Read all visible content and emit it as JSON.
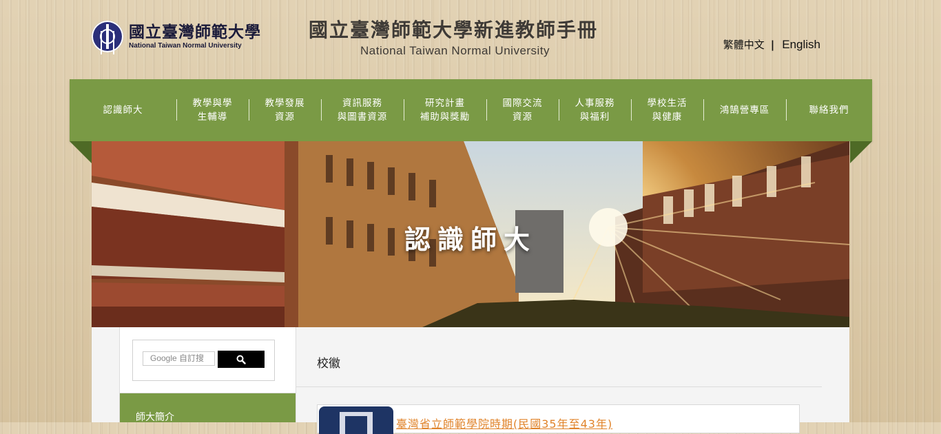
{
  "header": {
    "logo_zh": "國立臺灣師範大學",
    "logo_en": "National Taiwan Normal University",
    "site_title_zh": "國立臺灣師範大學新進教師手冊",
    "site_title_en": "National Taiwan Normal University",
    "lang_zh": "繁體中文",
    "lang_sep": "|",
    "lang_en": "English"
  },
  "nav": {
    "items": [
      {
        "line1": "認識師大",
        "line2": ""
      },
      {
        "line1": "教學與學",
        "line2": "生輔導"
      },
      {
        "line1": "教學發展",
        "line2": "資源"
      },
      {
        "line1": "資訊服務",
        "line2": "與圖書資源"
      },
      {
        "line1": "研究計畫",
        "line2": "補助與獎勵"
      },
      {
        "line1": "國際交流",
        "line2": "資源"
      },
      {
        "line1": "人事服務",
        "line2": "與福利"
      },
      {
        "line1": "學校生活",
        "line2": "與健康"
      },
      {
        "line1": "鴻鵠營專區",
        "line2": ""
      },
      {
        "line1": "聯絡我們",
        "line2": ""
      }
    ]
  },
  "hero": {
    "title": "認識師大"
  },
  "sidebar": {
    "search_placeholder": "自訂搜",
    "search_brand": "Google",
    "section_title": "師大簡介"
  },
  "main": {
    "title": "校徽",
    "card_link": "臺灣省立師範學院時期(民國35年至43年)"
  },
  "colors": {
    "nav_green": "#7a9a45",
    "link_orange": "#e0832a"
  },
  "icons": {
    "search_button": "search-icon"
  }
}
